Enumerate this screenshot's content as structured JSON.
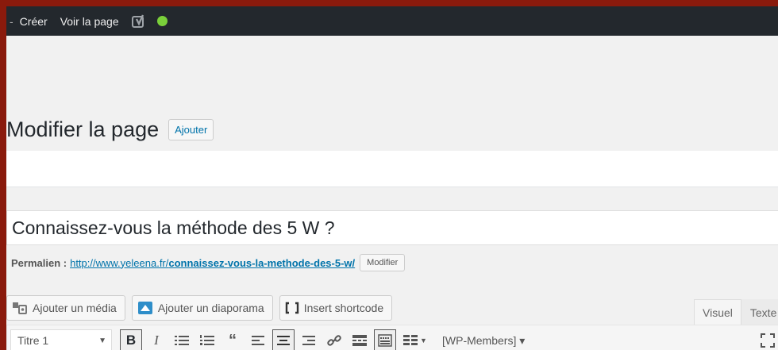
{
  "adminbar": {
    "dash": "-",
    "create": "Créer",
    "view_page": "Voir la page",
    "seo_icon": "yoast-icon",
    "status_color": "#7ad03a"
  },
  "header": {
    "title": "Modifier la page",
    "add_button": "Ajouter"
  },
  "post": {
    "title_value": "Connaissez-vous la méthode des 5 W ?",
    "permalink_label": "Permalien :",
    "permalink_base": "http://www.yeleena.fr/",
    "permalink_slug": "connaissez-vous-la-methode-des-5-w/",
    "permalink_edit": "Modifier"
  },
  "media_buttons": [
    {
      "label": "Ajouter un média",
      "icon": "media-icon"
    },
    {
      "label": "Ajouter un diaporama",
      "icon": "slideshow-icon"
    },
    {
      "label": "Insert shortcode",
      "icon": "brackets-icon"
    }
  ],
  "editor_tabs": {
    "visual": "Visuel",
    "text": "Texte"
  },
  "toolbar": {
    "format_value": "Titre 1",
    "bold": "B",
    "italic": "I",
    "wpmembers": "[WP-Members] ▾"
  },
  "colors": {
    "accent": "#0073aa",
    "adminbar_bg": "#23282d",
    "frame_bg": "#8a1a0c"
  }
}
